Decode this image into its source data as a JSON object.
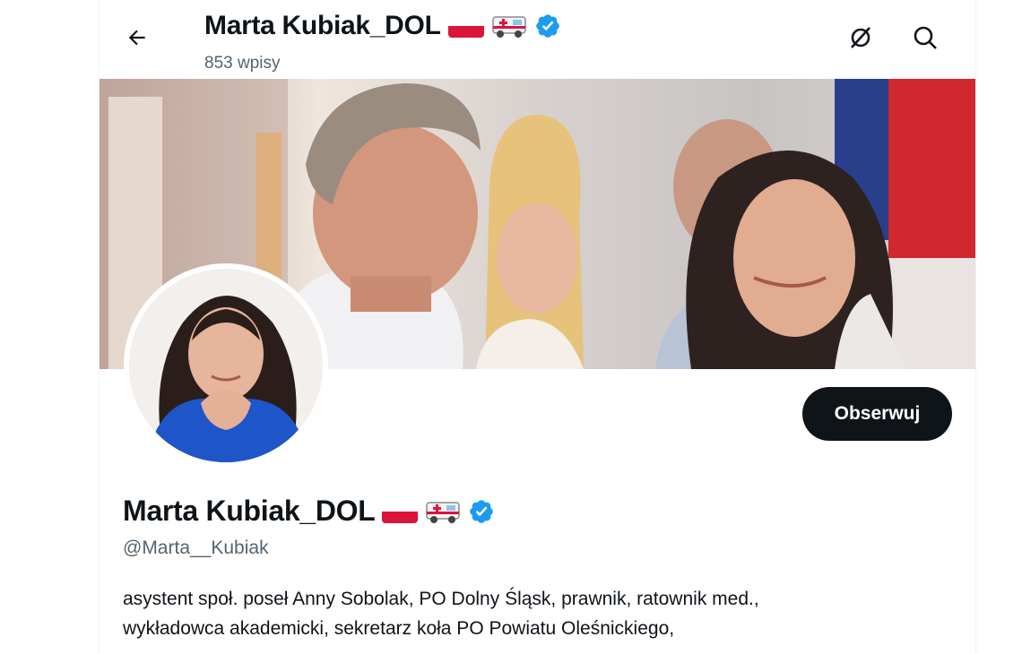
{
  "header": {
    "name": "Marta Kubiak_DOL",
    "post_count": "853 wpisy"
  },
  "icons": {
    "back": "arrow-left-icon",
    "grok": "grok-icon",
    "search": "search-icon",
    "flag": "poland-flag-emoji",
    "ambulance": "ambulance-emoji",
    "verified": "verified-badge-icon"
  },
  "profile": {
    "name": "Marta Kubiak_DOL",
    "handle": "@Marta__Kubiak",
    "bio_lines": [
      "asystent społ. poseł Anny Sobolak, PO Dolny Śląsk, prawnik, ratownik med.,",
      "wykładowca akademicki, sekretarz koła PO Powiatu Oleśnickiego,"
    ]
  },
  "actions": {
    "follow_label": "Obserwuj"
  },
  "colors": {
    "verified": "#1d9bf0",
    "follow_bg": "#0f1419",
    "secondary_text": "#536471"
  }
}
